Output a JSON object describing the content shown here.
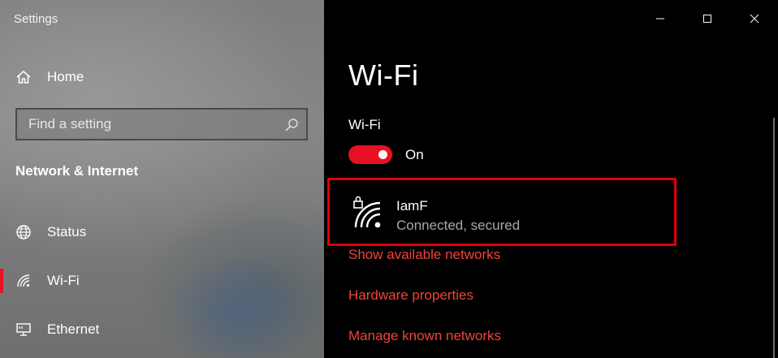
{
  "window": {
    "title": "Settings"
  },
  "sidebar": {
    "home_label": "Home",
    "search": {
      "placeholder": "Find a setting",
      "value": ""
    },
    "section_header": "Network & Internet",
    "items": [
      {
        "label": "Status",
        "icon": "globe-icon"
      },
      {
        "label": "Wi-Fi",
        "icon": "wifi-icon",
        "active": true
      },
      {
        "label": "Ethernet",
        "icon": "ethernet-icon"
      }
    ]
  },
  "main": {
    "title": "Wi-Fi",
    "wifi_toggle": {
      "label": "Wi-Fi",
      "state": "On",
      "on": true
    },
    "network": {
      "name": "IamF",
      "status": "Connected, secured",
      "icon": "wifi-secured-icon"
    },
    "links": {
      "show_networks": "Show available networks",
      "hardware": "Hardware properties",
      "manage": "Manage known networks"
    }
  },
  "colors": {
    "accent": "#e81123",
    "link": "#f0443a",
    "highlight_border": "#e00000"
  }
}
